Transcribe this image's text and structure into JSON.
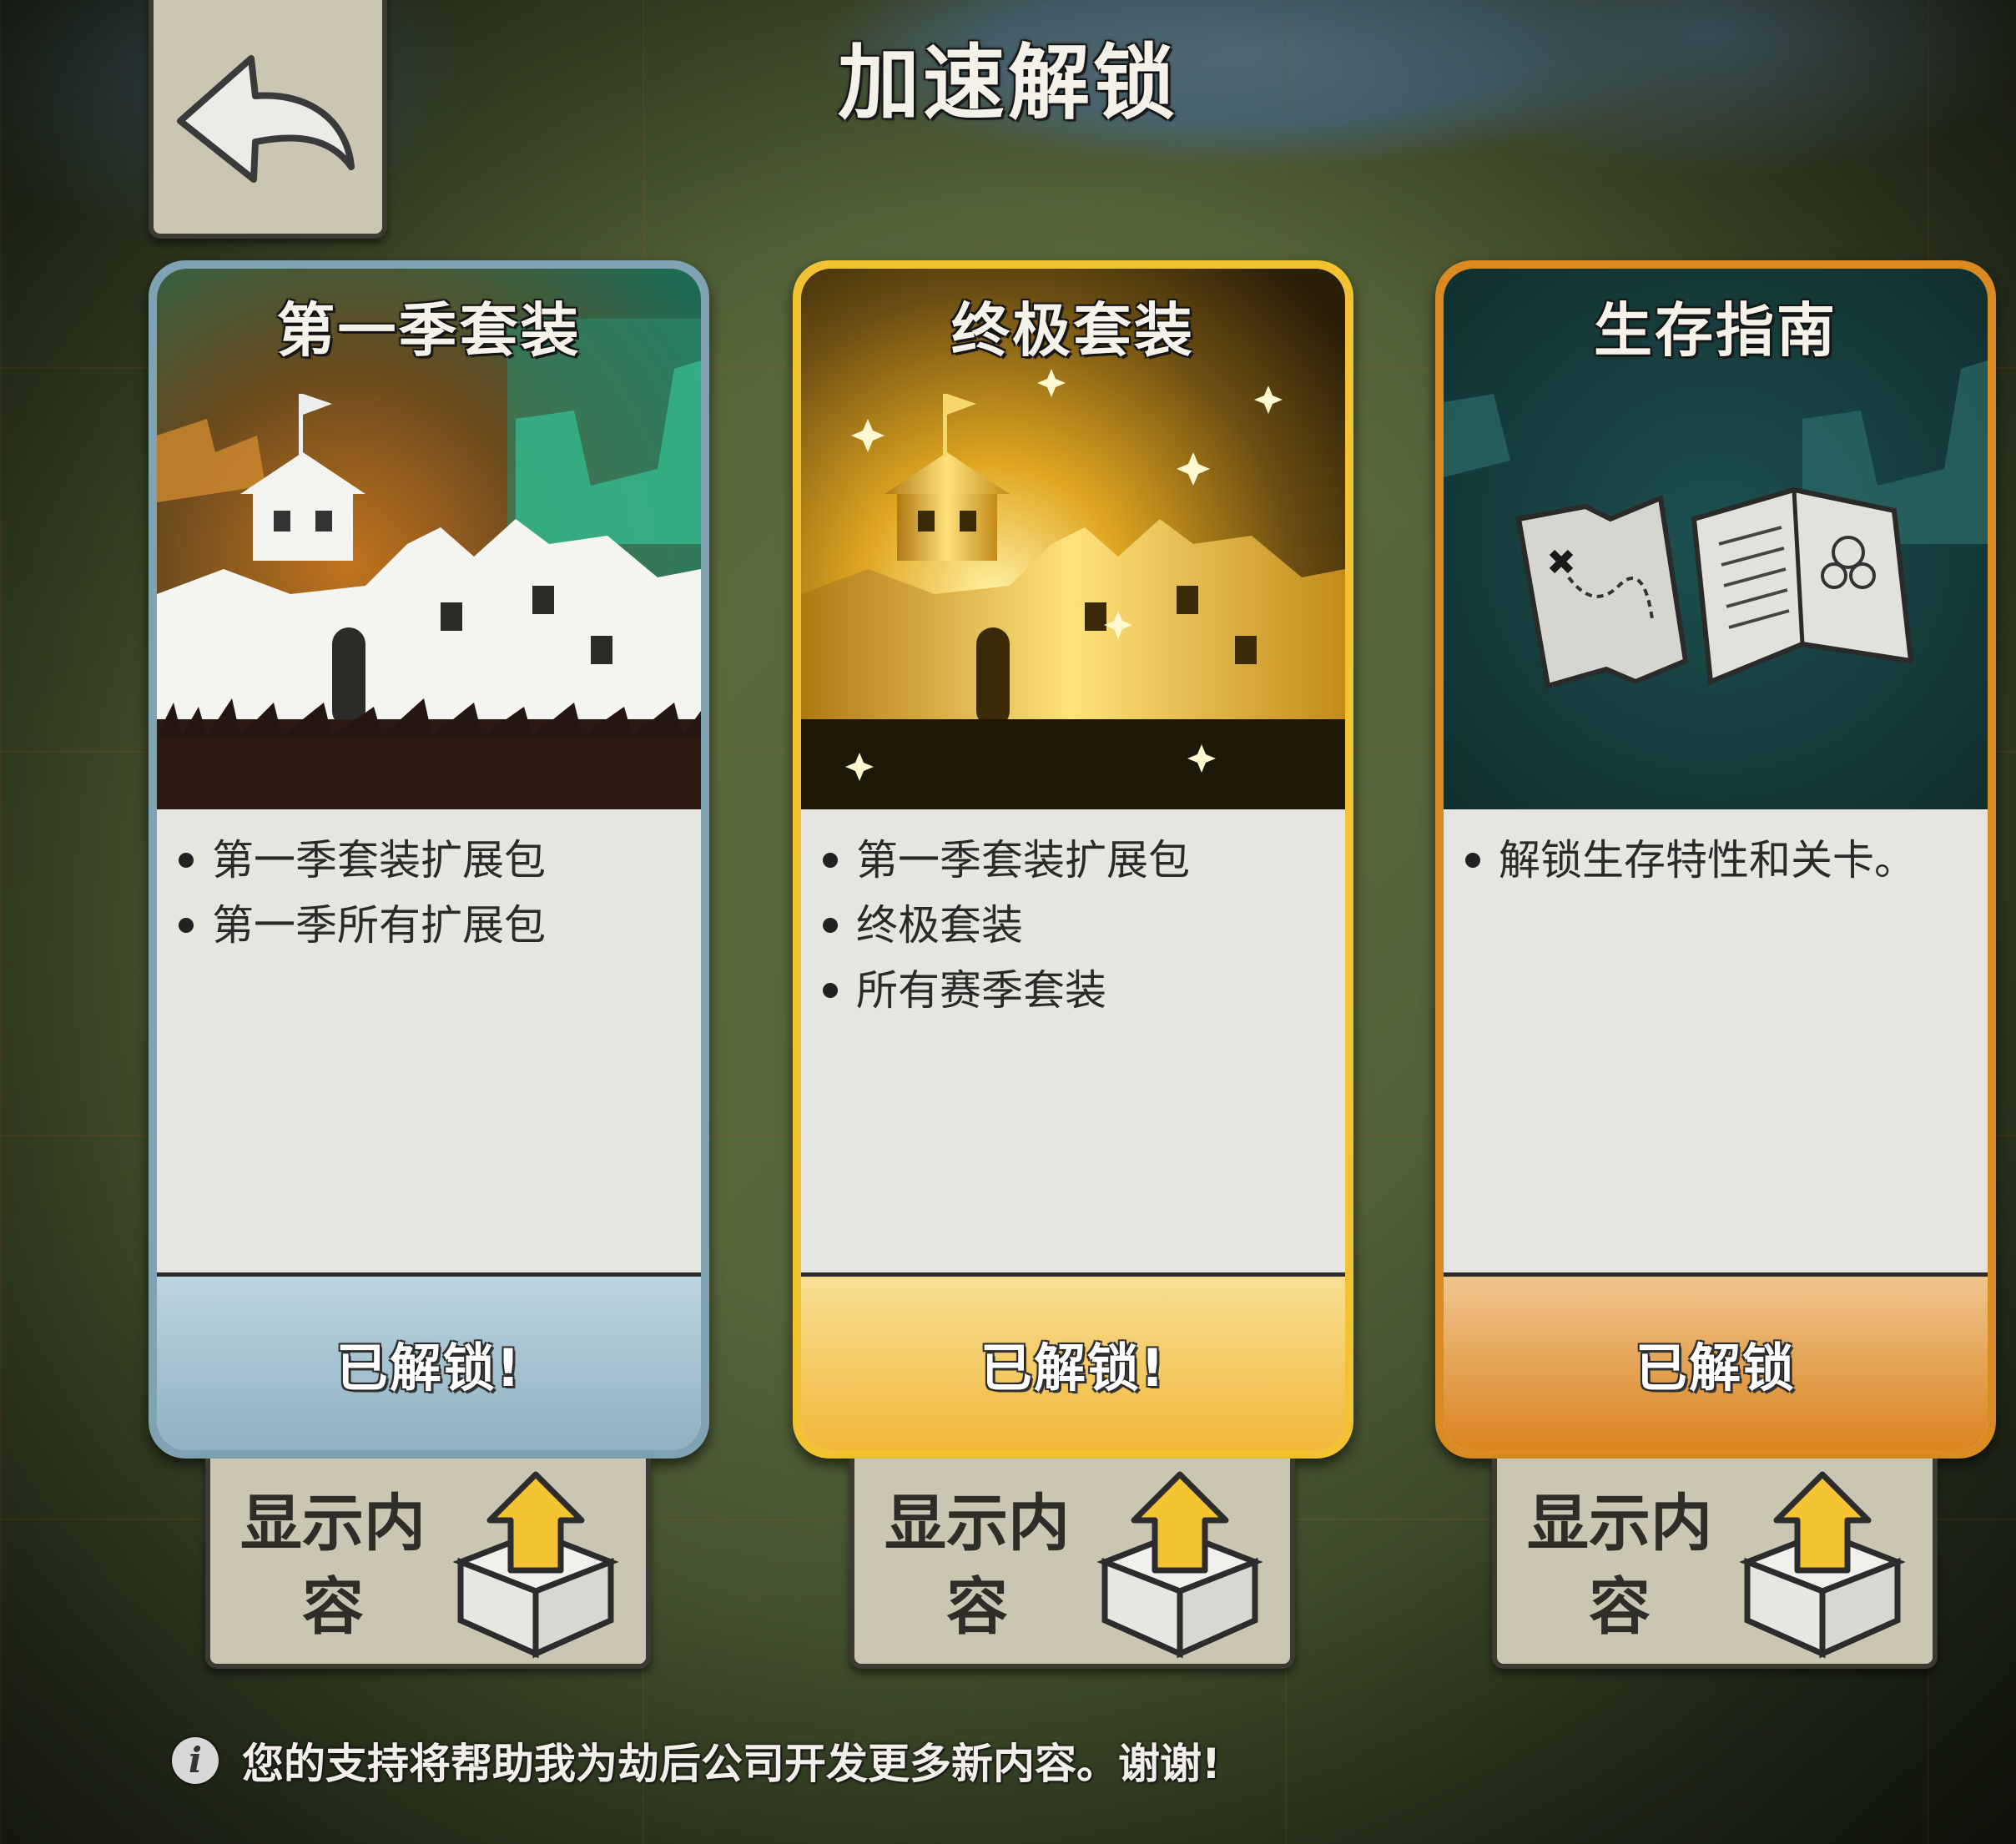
{
  "header": {
    "title": "加速解锁",
    "back_icon": "back-arrow-icon"
  },
  "cards": [
    {
      "title": "第一季套装",
      "features": [
        "第一季套装扩展包",
        "第一季所有扩展包"
      ],
      "status": "已解锁!",
      "accent": "#7fa3b2"
    },
    {
      "title": "终极套装",
      "features": [
        "第一季套装扩展包",
        "终极套装",
        "所有赛季套装"
      ],
      "status": "已解锁!",
      "accent": "#f2c230"
    },
    {
      "title": "生存指南",
      "features": [
        "解锁生存特性和关卡。"
      ],
      "status": "已解锁",
      "accent": "#d98a20"
    }
  ],
  "show_buttons": [
    {
      "label": "显示内容"
    },
    {
      "label": "显示内容"
    },
    {
      "label": "显示内容"
    }
  ],
  "footer": {
    "info_icon": "i",
    "text": "您的支持将帮助我为劫后公司开发更多新内容。谢谢!"
  }
}
